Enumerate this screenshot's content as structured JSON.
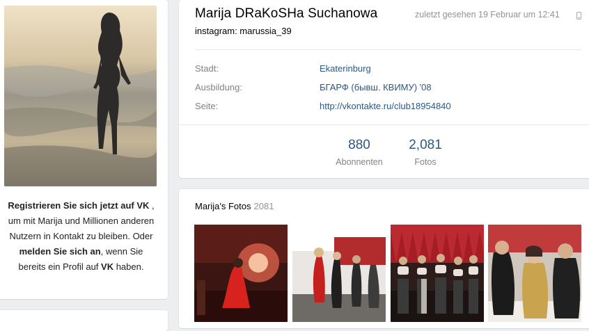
{
  "left_panel": {
    "register": {
      "part1": "Registrieren Sie sich jetzt auf VK",
      "part2": " , um mit Marija und Millionen anderen Nutzern in Kontakt zu bleiben. Oder ",
      "part3": "melden Sie sich an",
      "part4": ", wenn Sie bereits ein Profil auf ",
      "part5": "VK",
      "part6": " haben."
    }
  },
  "profile": {
    "name": "Marija DRaKoSHa Suchanowa",
    "status": "instagram: marussia_39",
    "last_seen": "zuletzt gesehen 19 Februar um 12:41",
    "info": [
      {
        "label": "Stadt:",
        "value": "Ekaterinburg"
      },
      {
        "label": "Ausbildung:",
        "value": "БГАРФ (бывш. КВИМУ) '08"
      },
      {
        "label": "Seite:",
        "value": "http://vkontakte.ru/club18954840"
      }
    ],
    "counters": [
      {
        "value": "880",
        "label": "Abonnenten"
      },
      {
        "value": "2,081",
        "label": "Fotos"
      }
    ]
  },
  "photos": {
    "title": "Marija's Fotos",
    "count": "2081"
  },
  "colors": {
    "link": "#2a5885",
    "muted": "#828282",
    "background": "#edeef0"
  },
  "icons": {
    "mobile": "mobile-phone-icon"
  }
}
